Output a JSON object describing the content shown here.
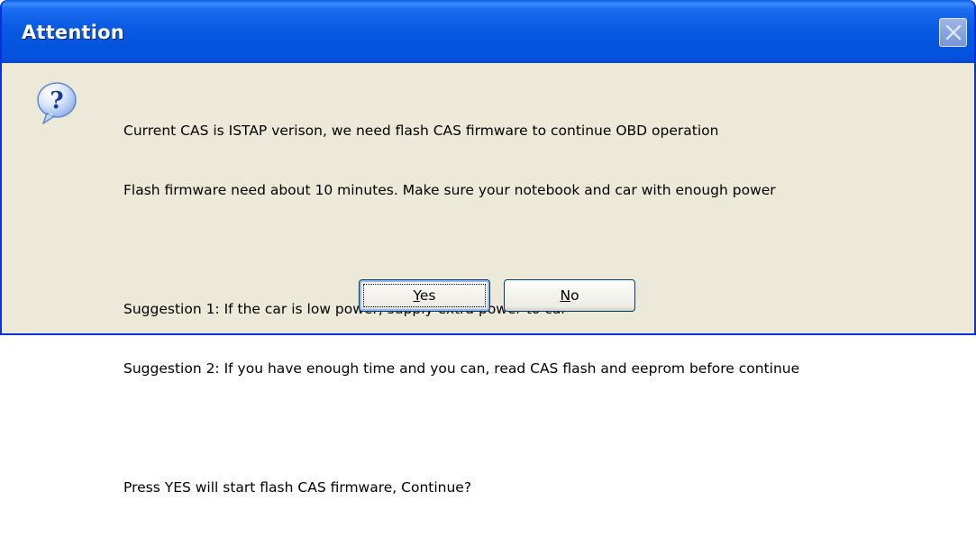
{
  "window": {
    "title": "Attention"
  },
  "icon": {
    "type": "question-icon",
    "glyph": "?"
  },
  "message": {
    "lines": [
      "Current CAS is ISTAP verison, we need flash CAS firmware to continue OBD operation",
      "Flash firmware need about 10 minutes. Make sure your notebook and car with enough power",
      "",
      "Suggestion 1: If the car is low power, supply extra power to car",
      "Suggestion 2: If you have enough time and you can, read CAS flash and eeprom before continue",
      "",
      "Press YES will start flash CAS firmware, Continue?"
    ]
  },
  "buttons": {
    "yes": {
      "mnemonic": "Y",
      "rest": "es"
    },
    "no": {
      "mnemonic": "N",
      "rest": "o"
    }
  },
  "colors": {
    "titlebar": "#0b5ce4",
    "frame": "#0831d9",
    "client": "#ece9d8",
    "button_border": "#003c74"
  }
}
